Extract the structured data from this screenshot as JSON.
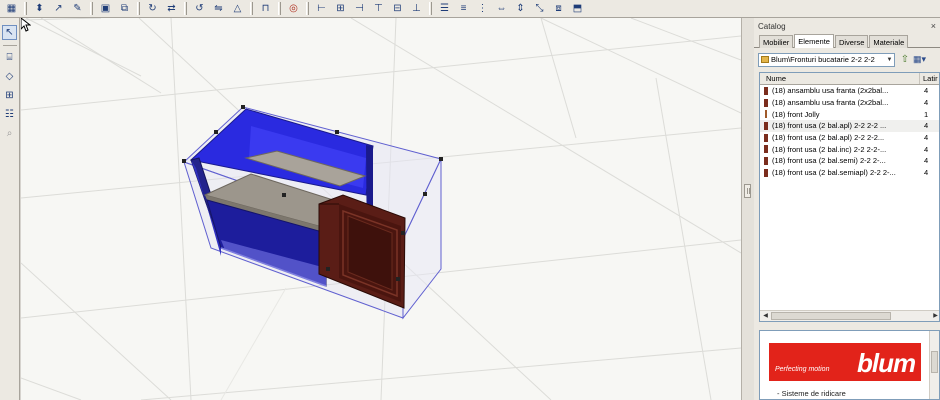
{
  "toolbar": {
    "icons": [
      "grid-icon",
      "select-icon",
      "move-icon",
      "edit-icon",
      "frame-icon",
      "group-icon",
      "rotate-icon",
      "flip-icon",
      "refresh-icon",
      "mirror-icon",
      "warning-icon",
      "panel-icon",
      "target-icon",
      "align-left-icon",
      "align-center-icon",
      "align-right-icon",
      "align-top-icon",
      "align-middle-icon",
      "align-bottom-icon",
      "distribute-h-icon",
      "distribute-v-icon",
      "distribute-depth-icon",
      "same-width-icon",
      "same-height-icon",
      "same-depth-icon",
      "stack-icon",
      "tilt-icon"
    ]
  },
  "left_toolbar": {
    "icons": [
      "pointer-icon",
      "cabinet-icon",
      "component-icon",
      "dimension-icon",
      "properties-icon",
      "zoom-icon"
    ]
  },
  "catalog": {
    "title": "Catalog",
    "close": "×",
    "tabs": [
      {
        "label": "Mobilier",
        "active": false
      },
      {
        "label": "Elemente",
        "active": true
      },
      {
        "label": "Diverse",
        "active": false
      },
      {
        "label": "Materiale",
        "active": false
      }
    ],
    "path": "Blum\\Fronturi bucatarie 2-2 2-2",
    "columns": {
      "name": "Nume",
      "width": "Latir"
    },
    "items": [
      {
        "name": "(18) ansamblu usa franta (2x2bal...",
        "width": "4",
        "icon": "door-icon",
        "selected": false
      },
      {
        "name": "(18) ansamblu usa franta (2x2bal...",
        "width": "4",
        "icon": "door-icon",
        "selected": false
      },
      {
        "name": "(18) front Jolly",
        "width": "1",
        "icon": "thin-panel-icon",
        "selected": false
      },
      {
        "name": "(18) front usa (2 bal.apl) 2-2 2-2 ...",
        "width": "4",
        "icon": "door-icon",
        "selected": true
      },
      {
        "name": "(18) front usa (2 bal.apl) 2-2 2-2...",
        "width": "4",
        "icon": "door-icon",
        "selected": false
      },
      {
        "name": "(18) front usa (2 bal.inc) 2-2 2-2-...",
        "width": "4",
        "icon": "door-icon",
        "selected": false
      },
      {
        "name": "(18) front usa (2 bal.semi) 2-2 2-...",
        "width": "4",
        "icon": "door-icon",
        "selected": false
      },
      {
        "name": "(18) front usa (2 bal.semiapl) 2-2 2-...",
        "width": "4",
        "icon": "door-icon",
        "selected": false
      }
    ],
    "preview": {
      "tagline": "Perfecting motion",
      "logo": "blum",
      "text": "- Sisteme de ridicare"
    }
  },
  "colors": {
    "cabinet_blue": "#2a2ae0",
    "cabinet_dark": "#1a1a8c",
    "door_wood": "#5a1d16",
    "brand_red": "#e2231a"
  }
}
